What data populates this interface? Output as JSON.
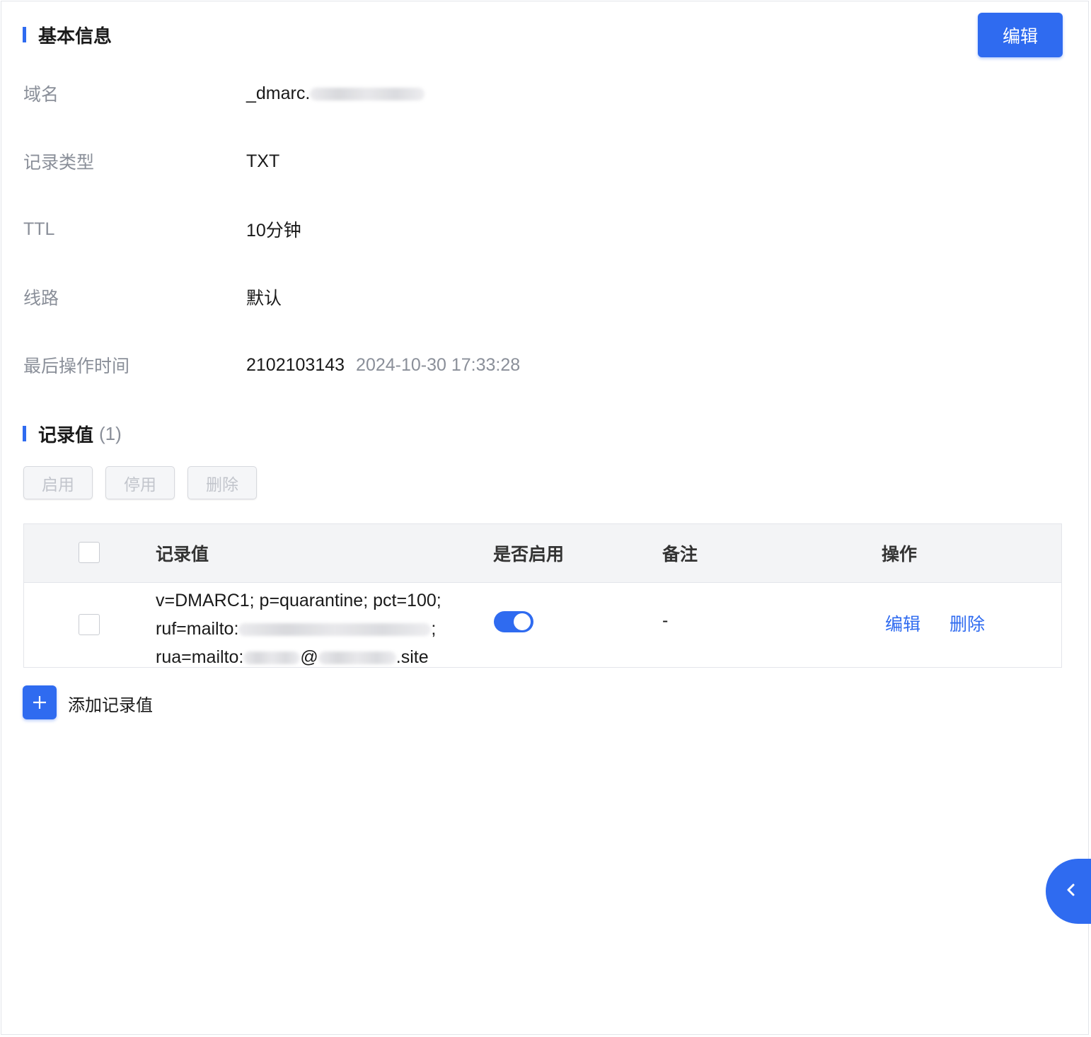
{
  "header": {
    "section_basic": "基本信息",
    "edit_label": "编辑"
  },
  "info": {
    "domain_label": "域名",
    "domain_value_prefix": "_dmarc.",
    "type_label": "记录类型",
    "type_value": "TXT",
    "ttl_label": "TTL",
    "ttl_value": "10分钟",
    "line_label": "线路",
    "line_value": "默认",
    "last_op_label": "最后操作时间",
    "last_op_user": "2102103143",
    "last_op_time": "2024-10-30 17:33:28"
  },
  "records": {
    "section_title": "记录值",
    "count": "(1)",
    "btn_enable": "启用",
    "btn_disable": "停用",
    "btn_delete": "删除",
    "columns": {
      "value": "记录值",
      "enabled": "是否启用",
      "remark": "备注",
      "actions": "操作"
    },
    "rows": [
      {
        "line1": "v=DMARC1; p=quarantine; pct=100;",
        "line2_prefix": "ruf=mailto:",
        "line2_suffix": ";",
        "line3_prefix": "rua=mailto:",
        "line3_mid": "@",
        "line3_suffix": ".site",
        "enabled": true,
        "remark": "-",
        "action_edit": "编辑",
        "action_delete": "删除"
      }
    ],
    "add_label": "添加记录值",
    "add_icon": "plus-icon"
  },
  "colors": {
    "accent": "#2f6bf0",
    "muted_text": "#8a8f99"
  }
}
